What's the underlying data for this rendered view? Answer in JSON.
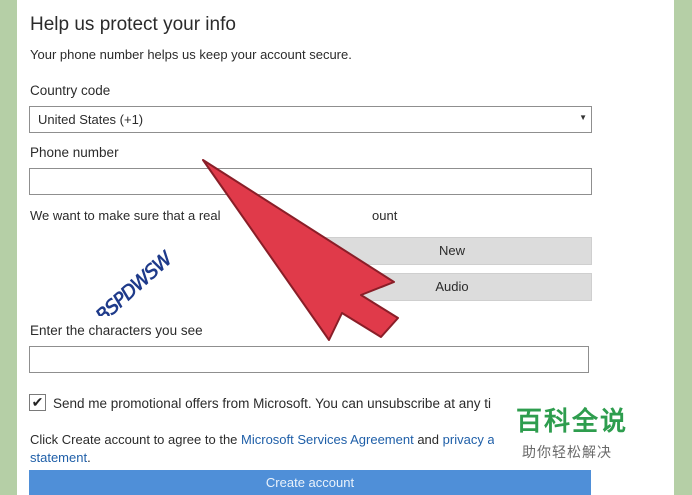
{
  "header": {
    "title": "Help us protect your info",
    "subtitle": "Your phone number helps us keep your account secure."
  },
  "country": {
    "label": "Country code",
    "value": "United States (+1)"
  },
  "phone": {
    "label": "Phone number",
    "value": ""
  },
  "captcha": {
    "intro_left": "We want to make sure that a real",
    "intro_right": "ount",
    "image_text": "BSPDWSW",
    "new_label": "New",
    "audio_label": "Audio",
    "input_label": "Enter the characters you see",
    "input_value": ""
  },
  "promo": {
    "checked": true,
    "check_glyph": "✔",
    "text": "Send me promotional offers from Microsoft. You can unsubscribe at any ti"
  },
  "agreement": {
    "prefix": "Click ",
    "bold": "Create account",
    "middle": " to agree to the ",
    "link1": "Microsoft Services Agreement",
    "and": " and ",
    "link2": "privacy a",
    "link2_cont": "statement",
    "suffix": "."
  },
  "create_button": "Create account",
  "watermark": {
    "big": "百科全说",
    "small": "助你轻松解决"
  },
  "colors": {
    "background": "#b5cfa6",
    "arrow": "#e03a4a",
    "button": "#4f8fd8",
    "link": "#1f5fa8",
    "watermark": "#2e9d4e"
  }
}
